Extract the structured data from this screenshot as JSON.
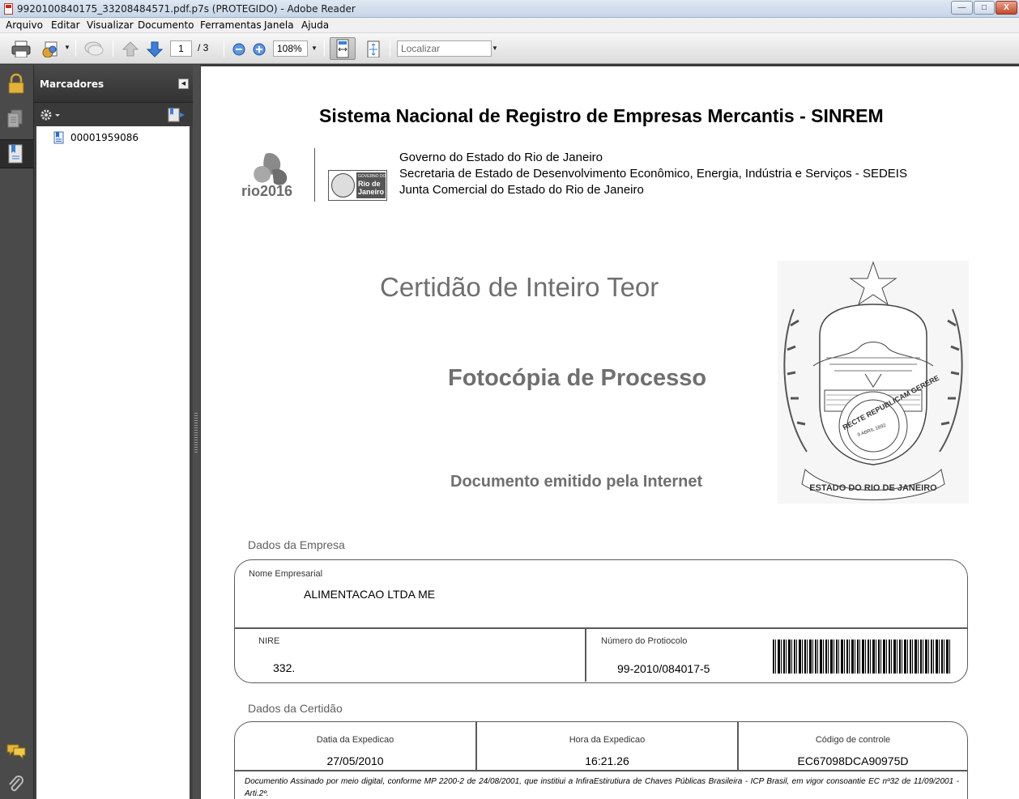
{
  "window": {
    "title": "9920100840175_33208484571.pdf.p7s (PROTEGIDO) - Adobe Reader",
    "controls": {
      "minimize": "—",
      "maximize": "□",
      "close": "X"
    }
  },
  "menu": [
    "Arquivo",
    "Editar",
    "Visualizar",
    "Documento",
    "Ferramentas",
    "Janela",
    "Ajuda"
  ],
  "toolbar": {
    "page_current": "1",
    "page_total": "/ 3",
    "zoom": "108%",
    "search_placeholder": "Localizar"
  },
  "bookmarks": {
    "title": "Marcadores",
    "items": [
      {
        "label": "00001959086"
      }
    ]
  },
  "document": {
    "title": "Sistema Nacional de Registro de Empresas Mercantis - SINREM",
    "logo_rio": "rio2016",
    "logo_state": [
      "GOVERNO DO",
      "Rio de",
      "Janeiro"
    ],
    "header_lines": [
      "Governo do Estado do Rio de Janeiro",
      "Secretaria de Estado de Desenvolvimento Econômico, Energia, Indústria e Serviços - SEDEIS",
      "Junta Comercial do Estado do Rio de Janeiro"
    ],
    "certidao_title": "Certidão de Inteiro Teor",
    "fotocopia_title": "Fotocópia de Processo",
    "emitido": "Documento emitido pela Internet",
    "seal": {
      "ring_text": "ESTADO DO RIO DE JANEIRO",
      "inner_text": "RECTE REPUBLICAM GERERE",
      "date_text": "9 ABRIL 1892"
    },
    "empresa": {
      "section_label": "Dados da Empresa",
      "nome_label": "Nome Empresarial",
      "nome_value": "ALIMENTACAO LTDA ME",
      "nire_label": "NIRE",
      "nire_value": "332.",
      "protocolo_label": "Número do Protiocolo",
      "protocolo_value": "99-2010/084017-5"
    },
    "certidao": {
      "section_label": "Dados da Certidão",
      "data_label": "Datia da Expedicao",
      "data_value": "27/05/2010",
      "hora_label": "Hora da Expedicao",
      "hora_value": "16:21.26",
      "codigo_label": "Código de controle",
      "codigo_value": "EC67098DCA90975D"
    },
    "footer": "Documentio Assinado por meio digital, conforme MP 2200-2 de 24/08/2001, que institiui a InfiraEstirutiura de Chaves Públicas Brasileira - ICP Brasil, em vigor consoantie EC nº32 de 11/09/2001 - Arti.2º."
  },
  "colors": {
    "accent_blue": "#2b6cc4",
    "panel_dark": "#404040",
    "title_grey": "#6f6f6f"
  }
}
